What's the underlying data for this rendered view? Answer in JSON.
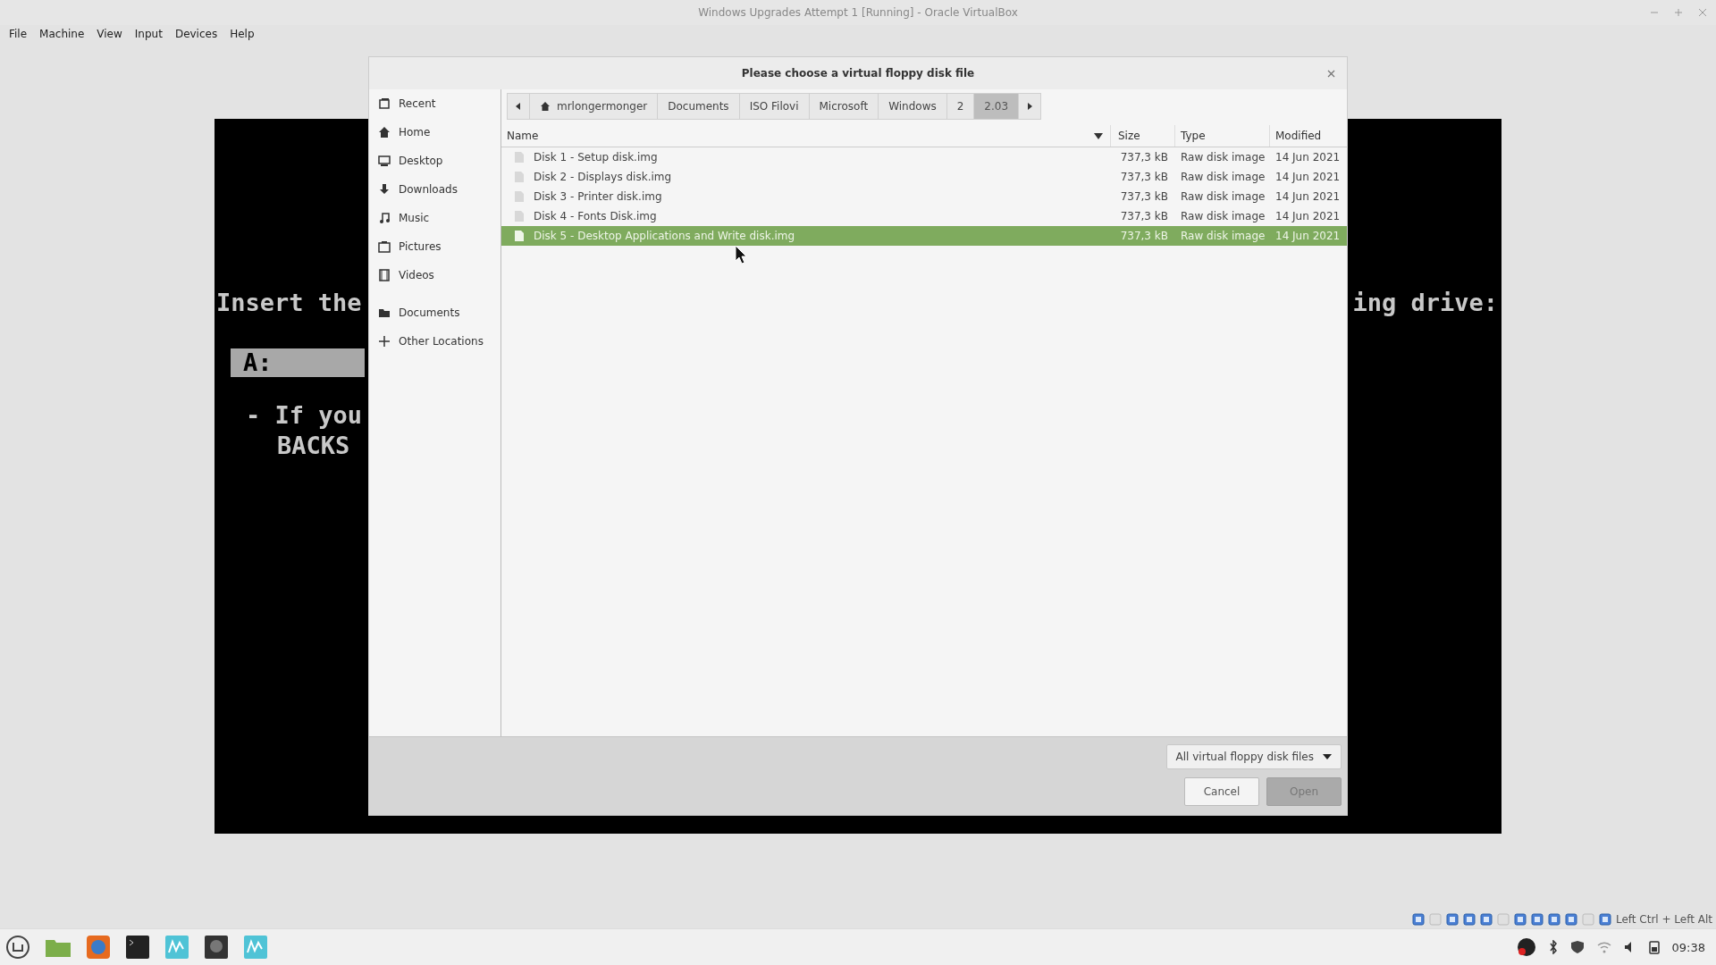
{
  "window": {
    "title": "Windows Upgrades Attempt 1 [Running] - Oracle VirtualBox"
  },
  "menu": [
    "File",
    "Machine",
    "View",
    "Input",
    "Devices",
    "Help"
  ],
  "vm_screen": {
    "line_1_left": "Insert the",
    "line_1_right": "ing drive:",
    "drive": "A:",
    "line_2": "- If you",
    "line_3": "BACKS"
  },
  "dialog": {
    "title": "Please choose a virtual floppy disk file",
    "places": [
      {
        "label": "Recent"
      },
      {
        "label": "Home"
      },
      {
        "label": "Desktop"
      },
      {
        "label": "Downloads"
      },
      {
        "label": "Music"
      },
      {
        "label": "Pictures"
      },
      {
        "label": "Videos"
      },
      {
        "label": "Documents"
      },
      {
        "label": "Other Locations"
      }
    ],
    "path": [
      {
        "label": "mrlongermonger",
        "selected": false
      },
      {
        "label": "Documents",
        "selected": false
      },
      {
        "label": "ISO Filovi",
        "selected": false
      },
      {
        "label": "Microsoft",
        "selected": false
      },
      {
        "label": "Windows",
        "selected": false
      },
      {
        "label": "2",
        "selected": false
      },
      {
        "label": "2.03",
        "selected": true
      }
    ],
    "columns": [
      "Name",
      "Size",
      "Type",
      "Modified"
    ],
    "files": [
      {
        "name": "Disk 1 - Setup disk.img",
        "size": "737,3 kB",
        "type": "Raw disk image",
        "modified": "14 Jun 2021",
        "selected": false
      },
      {
        "name": "Disk 2 - Displays disk.img",
        "size": "737,3 kB",
        "type": "Raw disk image",
        "modified": "14 Jun 2021",
        "selected": false
      },
      {
        "name": "Disk 3 - Printer disk.img",
        "size": "737,3 kB",
        "type": "Raw disk image",
        "modified": "14 Jun 2021",
        "selected": false
      },
      {
        "name": "Disk 4 - Fonts Disk.img",
        "size": "737,3 kB",
        "type": "Raw disk image",
        "modified": "14 Jun 2021",
        "selected": false
      },
      {
        "name": "Disk 5 - Desktop Applications and Write disk.img",
        "size": "737,3 kB",
        "type": "Raw disk image",
        "modified": "14 Jun 2021",
        "selected": true
      }
    ],
    "filter": "All virtual floppy disk files",
    "buttons": [
      {
        "label": "Cancel",
        "disabled": false
      },
      {
        "label": "Open",
        "disabled": true
      }
    ]
  },
  "status": {
    "host_key": "Left Ctrl + Left Alt"
  },
  "taskbar": {
    "clock": "09:38"
  }
}
